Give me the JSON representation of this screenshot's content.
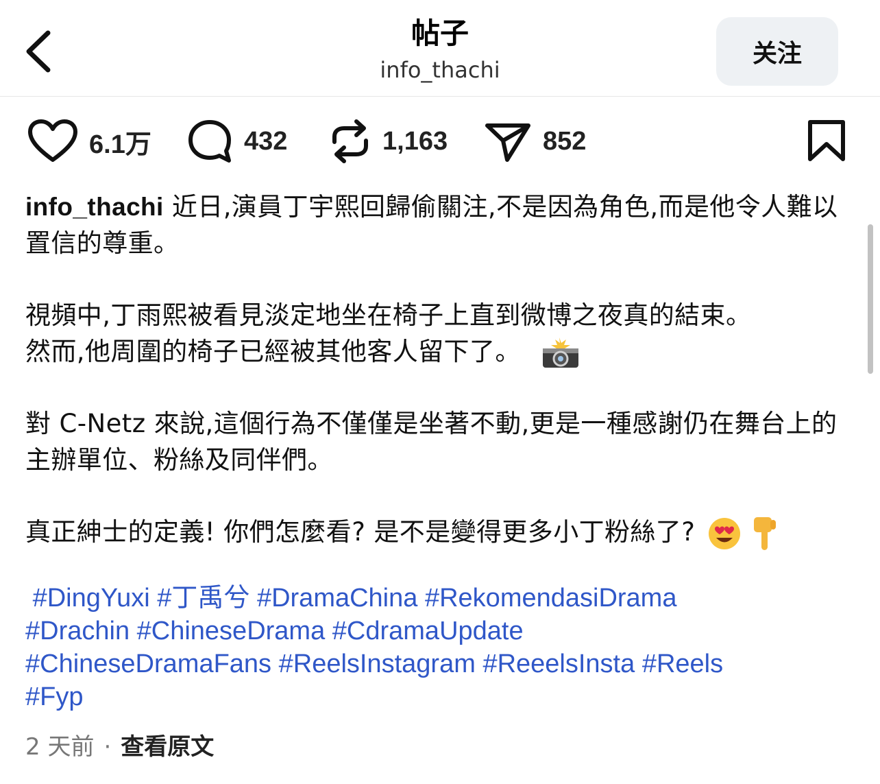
{
  "header": {
    "title": "帖子",
    "subtitle": "info_thachi",
    "follow_label": "关注"
  },
  "actions": {
    "likes": "6.1万",
    "comments": "432",
    "reposts": "1,163",
    "shares": "852"
  },
  "post": {
    "username": "info_thachi",
    "p1_text": " 近日,演員丁宇熙回歸偷關注,不是因為角色,而是他令人難以置信的尊重。",
    "p2_line1": "視頻中,丁雨熙被看見淡定地坐在椅子上直到微博之夜真的結束。",
    "p2_line2": "然而,他周圍的椅子已經被其他客人留下了。",
    "p3_text": "對 C-Netz 來說,這個行為不僅僅是坐著不動,更是一種感謝仍在舞台上的主辦單位、粉絲及同伴們。",
    "p4_text": "真正紳士的定義! 你們怎麼看? 是不是變得更多小丁粉絲了?",
    "hashtags": [
      "#DingYuxi",
      "#丁禹兮",
      "#DramaChina",
      "#RekomendasiDrama",
      "#Drachin",
      "#ChineseDrama",
      "#CdramaUpdate",
      "#ChineseDramaFans",
      "#ReelsInstagram",
      "#ReeelsInsta",
      "#Reels",
      "#Fyp"
    ]
  },
  "meta": {
    "time": "2 天前",
    "separator": "·",
    "see_original": "查看原文"
  },
  "colors": {
    "hashtag": "#2f57c8",
    "follow_bg": "#eef1f4"
  },
  "icons": [
    "back-arrow-icon",
    "heart-icon",
    "comment-icon",
    "repost-icon",
    "share-icon",
    "bookmark-icon",
    "camera-flash-emoji",
    "heart-eyes-emoji",
    "pointing-down-emoji"
  ]
}
